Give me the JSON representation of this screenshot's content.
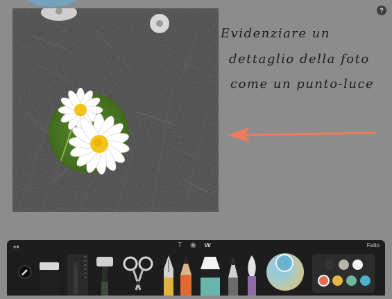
{
  "help": {
    "label": "?"
  },
  "note": {
    "lines": [
      "Evidenziare un",
      "dettaglio della foto",
      "come un punto-luce"
    ]
  },
  "toolbar": {
    "collapse_label": "◂◂",
    "text_label": "T",
    "camera_label": "◉",
    "brush_label": "\\/\\/",
    "done_label": "Fatto",
    "tools": [
      "eyedropper-icon",
      "eraser-icon",
      "fineliner-icon",
      "roller-icon",
      "scissors-icon",
      "fountain-pen-icon",
      "pencil-icon",
      "marker-icon",
      "pen-icon",
      "brush-icon"
    ],
    "colors": {
      "row1": [
        "#333333",
        "#b9b4ab",
        "#f4f4f4"
      ],
      "row2": [
        "#e76a4f",
        "#eab347",
        "#6cb8a0",
        "#4fb3cc"
      ],
      "selected": "#6cb3cf"
    }
  },
  "accent": {
    "arrow": "#ef7a5e",
    "highlight": "#7ea63e"
  }
}
